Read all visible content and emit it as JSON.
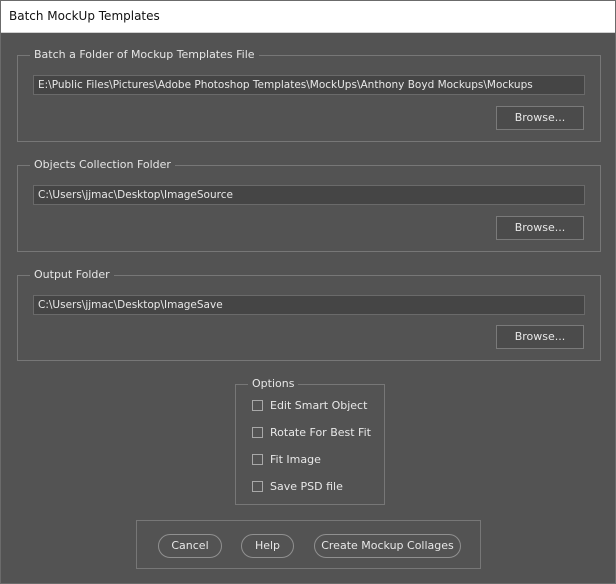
{
  "window": {
    "title": "Batch MockUp Templates"
  },
  "templates_folder": {
    "label": "Batch a Folder of Mockup Templates File",
    "path": "E:\\Public Files\\Pictures\\Adobe Photoshop Templates\\MockUps\\Anthony Boyd  Mockups\\Mockups",
    "browse_label": "Browse..."
  },
  "objects_folder": {
    "label": "Objects Collection Folder",
    "path": "C:\\Users\\jjmac\\Desktop\\ImageSource",
    "browse_label": "Browse..."
  },
  "output_folder": {
    "label": "Output Folder",
    "path": "C:\\Users\\jjmac\\Desktop\\ImageSave",
    "browse_label": "Browse..."
  },
  "options": {
    "label": "Options",
    "items": [
      {
        "label": "Edit Smart Object",
        "checked": false
      },
      {
        "label": "Rotate For Best Fit",
        "checked": false
      },
      {
        "label": "Fit Image",
        "checked": false
      },
      {
        "label": "Save PSD file",
        "checked": false
      }
    ]
  },
  "actions": {
    "cancel_label": "Cancel",
    "help_label": "Help",
    "create_label": "Create Mockup Collages"
  },
  "colors": {
    "panel_background": "#535353",
    "field_background": "#454545",
    "border": "#777777",
    "text": "#e8e8e8"
  }
}
